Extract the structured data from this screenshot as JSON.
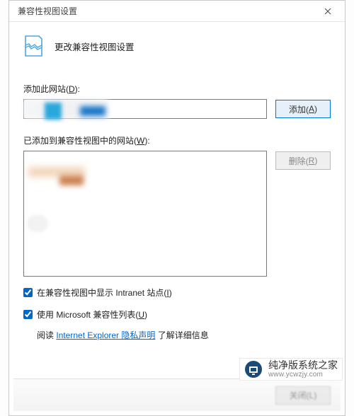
{
  "dialog": {
    "title": "兼容性视图设置",
    "header_text": "更改兼容性视图设置",
    "add_label_prefix": "添加此网站(",
    "add_label_key": "D",
    "add_label_suffix": "):",
    "add_button_prefix": "添加(",
    "add_button_key": "A",
    "add_button_suffix": ")",
    "added_label_prefix": "已添加到兼容性视图中的网站(",
    "added_label_key": "W",
    "added_label_suffix": "):",
    "remove_button_prefix": "删除(",
    "remove_button_key": "R",
    "remove_button_suffix": ")",
    "checkbox_intranet_prefix": "在兼容性视图中显示 Intranet 站点(",
    "checkbox_intranet_key": "I",
    "checkbox_intranet_suffix": ")",
    "checkbox_mslist_prefix": "使用 Microsoft 兼容性列表(",
    "checkbox_mslist_key": "U",
    "checkbox_mslist_suffix": ")",
    "link_pre": "阅读 ",
    "link_text": "Internet Explorer 隐私声明",
    "link_post": " 了解详细信息",
    "close_button": "关闭(L)"
  },
  "watermark": {
    "cn": "纯净版系统之家",
    "url": "www.ycwzjy.com"
  }
}
